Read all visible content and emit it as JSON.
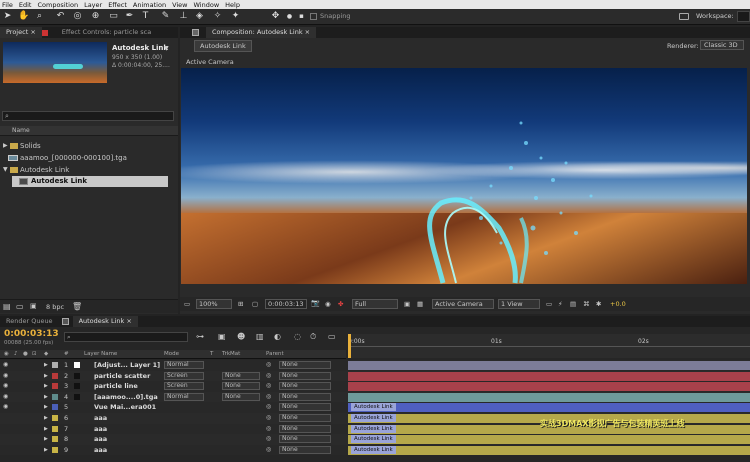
{
  "menu": [
    "File",
    "Edit",
    "Composition",
    "Layer",
    "Effect",
    "Animation",
    "View",
    "Window",
    "Help"
  ],
  "toolbar": {
    "snapping": "Snapping",
    "workspace": "Workspace:"
  },
  "project": {
    "tab_project": "Project",
    "tab_effects": "Effect Controls: particle sca",
    "comp_name": "Autodesk Link",
    "comp_size": "950 x 350 (1.00)",
    "comp_dur": "Δ 0:00:04:00, 25....",
    "col_name": "Name",
    "items": [
      {
        "label": "Solids",
        "kind": "folder"
      },
      {
        "label": "aaamoo_[000000-000100].tga",
        "kind": "footage"
      },
      {
        "label": "Autodesk Link",
        "kind": "folder"
      },
      {
        "label": "Autodesk Link",
        "kind": "comp"
      }
    ],
    "bpc": "8 bpc"
  },
  "comp": {
    "tab": "Composition: Autodesk Link",
    "subtab": "Autodesk Link",
    "renderer_label": "Renderer:",
    "renderer": "Classic 3D",
    "active_camera": "Active Camera",
    "zoom": "100%",
    "time": "0:00:03:13",
    "quality": "Full",
    "view": "Active Camera",
    "views": "1 View",
    "exposure": "+0.0"
  },
  "timeline": {
    "tab_render": "Render Queue",
    "tab_comp": "Autodesk Link",
    "time": "0:00:03:13",
    "frames": "00088 (25.00 fps)",
    "cols": {
      "num": "#",
      "name": "Layer Name",
      "mode": "Mode",
      "t": "T",
      "trkmat": "TrkMat",
      "parent": "Parent"
    },
    "ruler": [
      "0:00s",
      "01s",
      "02s"
    ],
    "layers": [
      {
        "num": "1",
        "name": "[Adjust... Layer 1]",
        "mode": "Normal",
        "trk": "",
        "parent": "None",
        "color": "#b0b0b0",
        "bar": "#7c7c98",
        "barlabel": ""
      },
      {
        "num": "2",
        "name": "particle scatter",
        "mode": "Screen",
        "trk": "None",
        "parent": "None",
        "color": "#b83a3a",
        "bar": "#a8414b",
        "barlabel": ""
      },
      {
        "num": "3",
        "name": "particle line",
        "mode": "Screen",
        "trk": "None",
        "parent": "None",
        "color": "#b83a3a",
        "bar": "#a8414b",
        "barlabel": ""
      },
      {
        "num": "4",
        "name": "[aaamoo....0].tga",
        "mode": "Normal",
        "trk": "None",
        "parent": "None",
        "color": "#5f8c8c",
        "bar": "#6e9a9a",
        "barlabel": ""
      },
      {
        "num": "5",
        "name": "Vue Mai...era001",
        "mode": "",
        "trk": "",
        "parent": "None",
        "color": "#4a5fb8",
        "bar": "#4f5fc0",
        "barlabel": "Autodesk Link"
      },
      {
        "num": "6",
        "name": "aaa",
        "mode": "",
        "trk": "",
        "parent": "None",
        "color": "#c8b446",
        "bar": "#b5a84a",
        "barlabel": "Autodesk Link"
      },
      {
        "num": "7",
        "name": "aaa",
        "mode": "",
        "trk": "",
        "parent": "None",
        "color": "#c8b446",
        "bar": "#b5a84a",
        "barlabel": "Autodesk Link"
      },
      {
        "num": "8",
        "name": "aaa",
        "mode": "",
        "trk": "",
        "parent": "None",
        "color": "#c8b446",
        "bar": "#b5a84a",
        "barlabel": "Autodesk Link"
      },
      {
        "num": "9",
        "name": "aaa",
        "mode": "",
        "trk": "",
        "parent": "None",
        "color": "#c8b446",
        "bar": "#b5a84a",
        "barlabel": "Autodesk Link"
      }
    ],
    "watermark": "实战3DMAX影视广告与包装精英班上线"
  }
}
